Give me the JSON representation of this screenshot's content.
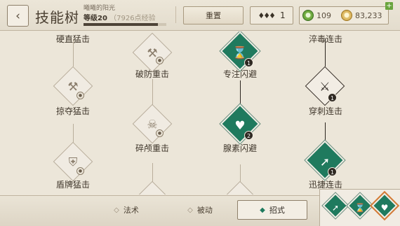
{
  "header": {
    "back_icon": "chevron-left-icon",
    "title": "技能树",
    "player_name": "曦曦的阳光",
    "level_label": "等级20",
    "xp_text": "7926点经验",
    "xp_progress": 0.9,
    "reset_label": "重置",
    "skill_points_icon": "triple-diamond-icon",
    "skill_points": "1",
    "green_currency_icon": "green-coin-icon",
    "green_currency": "109",
    "gold_currency_icon": "gold-coin-icon",
    "gold_currency": "83,233",
    "add_icon": "plus-icon"
  },
  "tree": {
    "nodes": [
      {
        "label": "硬直猛击",
        "icon": "fist-icon",
        "state": "locked"
      },
      {
        "label": "掠夺猛击",
        "icon": "hammer-icon",
        "state": "locked"
      },
      {
        "label": "盾牌猛击",
        "icon": "shield-icon",
        "state": "locked"
      },
      {
        "label": "破防重击",
        "icon": "axe-icon",
        "state": "locked"
      },
      {
        "label": "碎颅重击",
        "icon": "skull-icon",
        "state": "locked"
      },
      {
        "label": "专注闪避",
        "icon": "hourglass-icon",
        "state": "learned",
        "rank": "1"
      },
      {
        "label": "腺素闪避",
        "icon": "heart-icon",
        "state": "learned",
        "rank": "2"
      },
      {
        "label": "淬毒连击",
        "icon": "poison-icon",
        "state": "partial"
      },
      {
        "label": "穿刺连击",
        "icon": "dagger-icon",
        "state": "available",
        "rank": "1"
      },
      {
        "label": "迅捷连击",
        "icon": "swift-blade-icon",
        "state": "learned",
        "rank": "1"
      }
    ]
  },
  "categories": [
    {
      "label": "法术",
      "icon": "diamond-outline-icon"
    },
    {
      "label": "被动",
      "icon": "diamond-outline-icon"
    },
    {
      "label": "招式",
      "icon": "diamond-filled-icon",
      "active": true
    }
  ],
  "equipped": [
    {
      "icon": "swift-blade-icon"
    },
    {
      "icon": "hourglass-icon"
    },
    {
      "icon": "heart-icon",
      "selected": true
    }
  ],
  "colors": {
    "learned_green": "#1f7a5e",
    "selected_orange": "#d67a34",
    "background": "#ece6d9"
  }
}
